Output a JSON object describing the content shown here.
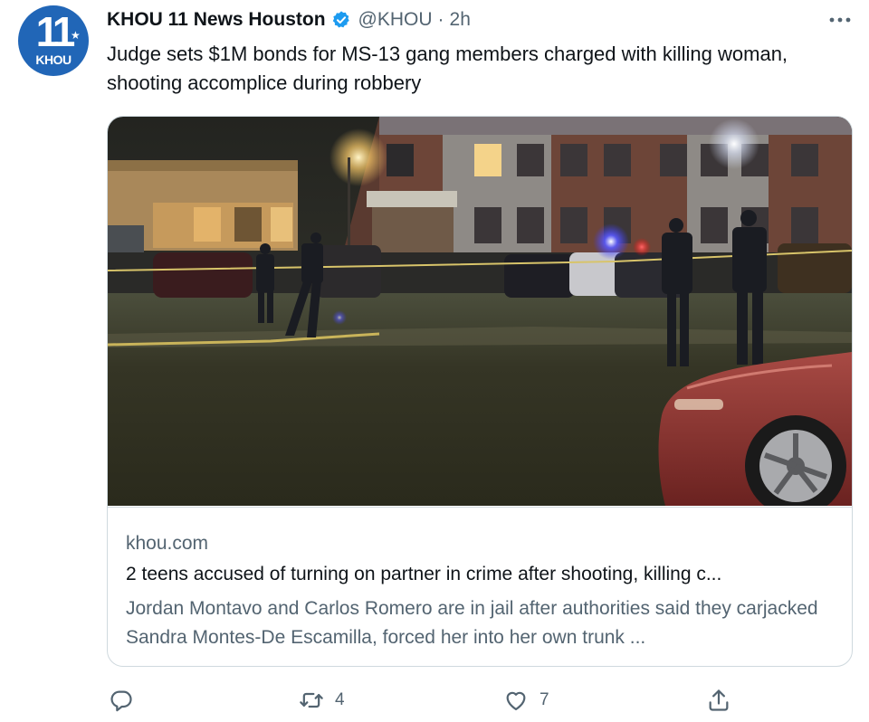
{
  "account": {
    "logo_number": "11",
    "logo_text": "KHOU",
    "display_name": "KHOU 11 News Houston",
    "handle": "@KHOU",
    "separator": "·",
    "time": "2h"
  },
  "tweet": {
    "text": "Judge sets $1M bonds for MS-13 gang members charged with killing woman, shooting accomplice during robbery"
  },
  "card": {
    "domain": "khou.com",
    "title": "2 teens accused of turning on partner in crime after shooting, killing c...",
    "description": "Jordan Montavo and Carlos Romero are in jail after authorities said they carjacked Sandra Montes-De Escamilla, forced her into her own trunk ..."
  },
  "actions": {
    "reply_count": "",
    "retweet_count": "4",
    "like_count": "7"
  },
  "icons": [
    "verified-badge-icon",
    "more-icon",
    "reply-icon",
    "retweet-icon",
    "like-icon",
    "share-icon"
  ],
  "colors": {
    "brand_blue": "#2166b7",
    "verified_blue": "#1d9bf0",
    "secondary_text": "#536471",
    "border": "#cfd9de"
  }
}
